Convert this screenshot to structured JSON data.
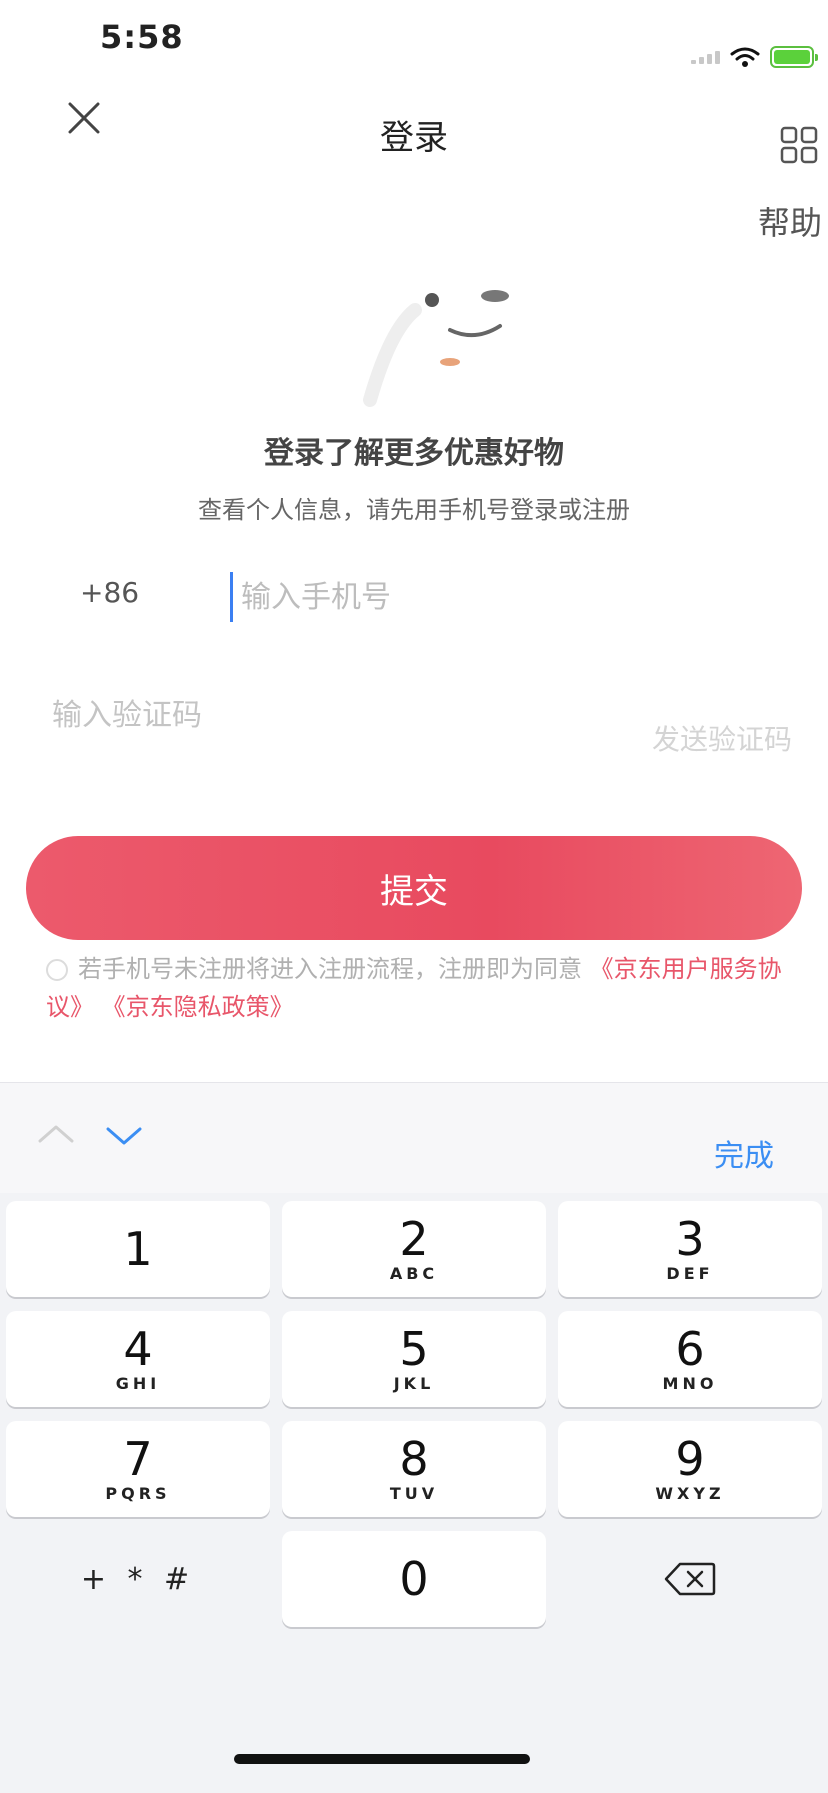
{
  "status_bar": {
    "time": "5:58"
  },
  "nav": {
    "title": "登录",
    "help_label": "帮助"
  },
  "intro": {
    "headline": "登录了解更多优惠好物",
    "subline": "查看个人信息，请先用手机号登录或注册"
  },
  "form": {
    "country_code": "+86",
    "phone_placeholder": "输入手机号",
    "code_placeholder": "输入验证码",
    "send_code_label": "发送验证码",
    "submit_label": "提交"
  },
  "agreement": {
    "text": "若手机号未注册将进入注册流程，注册即为同意",
    "link_user_service": "《京东用户服务协议》",
    "link_privacy": "《京东隐私政策》"
  },
  "keyboard": {
    "done_label": "完成",
    "keys": [
      {
        "digit": "1",
        "letters": ""
      },
      {
        "digit": "2",
        "letters": "ABC"
      },
      {
        "digit": "3",
        "letters": "DEF"
      },
      {
        "digit": "4",
        "letters": "GHI"
      },
      {
        "digit": "5",
        "letters": "JKL"
      },
      {
        "digit": "6",
        "letters": "MNO"
      },
      {
        "digit": "7",
        "letters": "PQRS"
      },
      {
        "digit": "8",
        "letters": "TUV"
      },
      {
        "digit": "9",
        "letters": "WXYZ"
      }
    ],
    "symbols_label": "+ * #",
    "zero": "0"
  },
  "colors": {
    "accent_red": "#e84a5f",
    "link_blue": "#3b8ef3",
    "battery_green": "#5bd13b"
  }
}
